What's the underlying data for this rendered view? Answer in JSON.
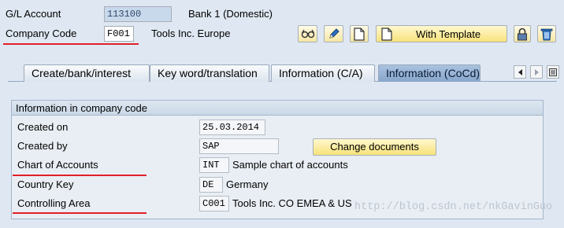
{
  "header": {
    "gl_account_label": "G/L Account",
    "gl_account_value": "113100",
    "gl_account_name": "Bank 1 (Domestic)",
    "company_code_label": "Company Code",
    "company_code_value": "F001",
    "company_code_name": "Tools Inc. Europe"
  },
  "toolbar": {
    "with_template_label": "With Template",
    "icons": [
      "glasses-icon",
      "pencil-icon",
      "document-icon",
      "template-document-icon",
      "lock-icon",
      "trash-icon"
    ]
  },
  "tabs": [
    {
      "label": "Create/bank/interest"
    },
    {
      "label": "Key word/translation"
    },
    {
      "label": "Information (C/A)"
    },
    {
      "label": "Information (CoCd)",
      "active": true
    }
  ],
  "group": {
    "title": "Information in company code",
    "change_documents_label": "Change documents",
    "fields": [
      {
        "label": "Created on",
        "value": "25.03.2014",
        "text": ""
      },
      {
        "label": "Created by",
        "value": "SAP",
        "text": ""
      },
      {
        "label": "Chart of Accounts",
        "value": "INT",
        "text": "Sample chart of accounts"
      },
      {
        "label": "Country Key",
        "value": "DE",
        "text": "Germany"
      },
      {
        "label": "Controlling Area",
        "value": "C001",
        "text": "Tools Inc. CO EMEA & US"
      }
    ]
  },
  "watermark": "http://blog.csdn.net/nkGavinGuo",
  "colors": {
    "annotation_red": "#e0202a",
    "active_tab": "#87a6cb",
    "button_yellow": "#f7e27a"
  }
}
